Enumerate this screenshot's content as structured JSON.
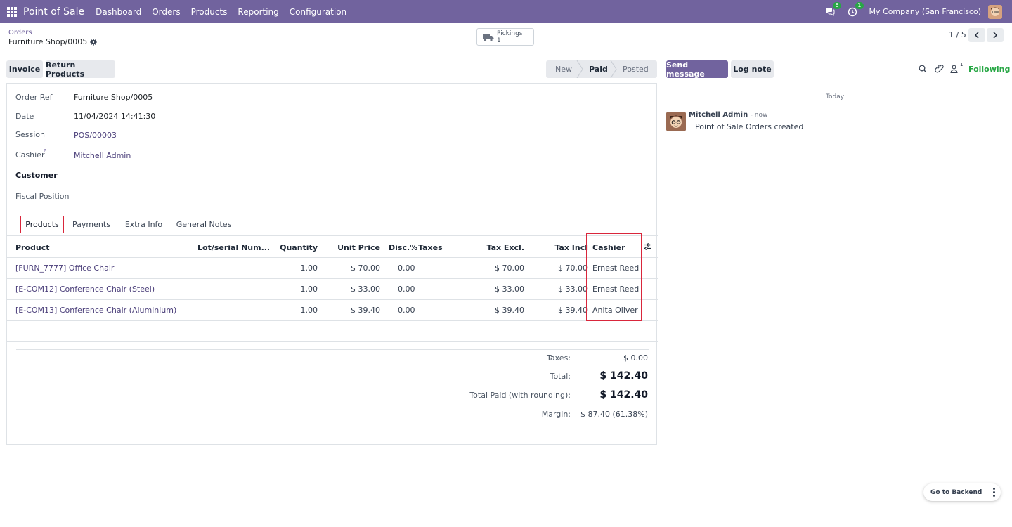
{
  "app": {
    "name": "Point of Sale",
    "menu": [
      "Dashboard",
      "Orders",
      "Products",
      "Reporting",
      "Configuration"
    ],
    "messages_badge": "6",
    "activity_badge": "1",
    "company": "My Company (San Francisco)"
  },
  "breadcrumb": {
    "parent": "Orders",
    "current": "Furniture Shop/0005"
  },
  "smart_button": {
    "label": "Pickings",
    "count": "1"
  },
  "pager": {
    "value": "1 / 5"
  },
  "actions": {
    "invoice": "Invoice",
    "return_products": "Return Products"
  },
  "status": {
    "stages": [
      "New",
      "Paid",
      "Posted"
    ],
    "active": "Paid"
  },
  "form": {
    "order_ref_label": "Order Ref",
    "order_ref": "Furniture Shop/0005",
    "date_label": "Date",
    "date": "11/04/2024 14:41:30",
    "session_label": "Session",
    "session": "POS/00003",
    "cashier_label": "Cashier",
    "cashier_help": "?",
    "cashier": "Mitchell Admin",
    "customer_label": "Customer",
    "fiscal_label": "Fiscal Position"
  },
  "tabs": [
    "Products",
    "Payments",
    "Extra Info",
    "General Notes"
  ],
  "table": {
    "headers": {
      "product": "Product",
      "lot": "Lot/serial Num...",
      "qty": "Quantity",
      "unit_price": "Unit Price",
      "disc": "Disc.%",
      "taxes": "Taxes",
      "tax_excl": "Tax Excl.",
      "tax_incl": "Tax Incl",
      "cashier": "Cashier"
    },
    "rows": [
      {
        "product": "[FURN_7777] Office Chair",
        "qty": "1.00",
        "unit_price": "$ 70.00",
        "disc": "0.00",
        "tax_excl": "$ 70.00",
        "tax_incl": "$ 70.00",
        "cashier": "Ernest Reed"
      },
      {
        "product": "[E-COM12] Conference Chair (Steel)",
        "qty": "1.00",
        "unit_price": "$ 33.00",
        "disc": "0.00",
        "tax_excl": "$ 33.00",
        "tax_incl": "$ 33.00",
        "cashier": "Ernest Reed"
      },
      {
        "product": "[E-COM13] Conference Chair (Aluminium)",
        "qty": "1.00",
        "unit_price": "$ 39.40",
        "disc": "0.00",
        "tax_excl": "$ 39.40",
        "tax_incl": "$ 39.40",
        "cashier": "Anita Oliver"
      }
    ]
  },
  "totals": {
    "taxes_label": "Taxes:",
    "taxes": "$ 0.00",
    "total_label": "Total:",
    "total": "$ 142.40",
    "paid_label": "Total Paid (with rounding):",
    "paid": "$ 142.40",
    "margin_label": "Margin:",
    "margin": "$ 87.40 (61.38%)"
  },
  "chatter": {
    "send_message": "Send message",
    "log_note": "Log note",
    "followers_count": "1",
    "following": "Following",
    "today": "Today",
    "author": "Mitchell Admin",
    "time": "- now",
    "body": "Point of Sale Orders created"
  },
  "go_backend": "Go to Backend",
  "colors": {
    "brand": "#71639e",
    "highlight": "#d9263b",
    "following": "#28a745"
  }
}
